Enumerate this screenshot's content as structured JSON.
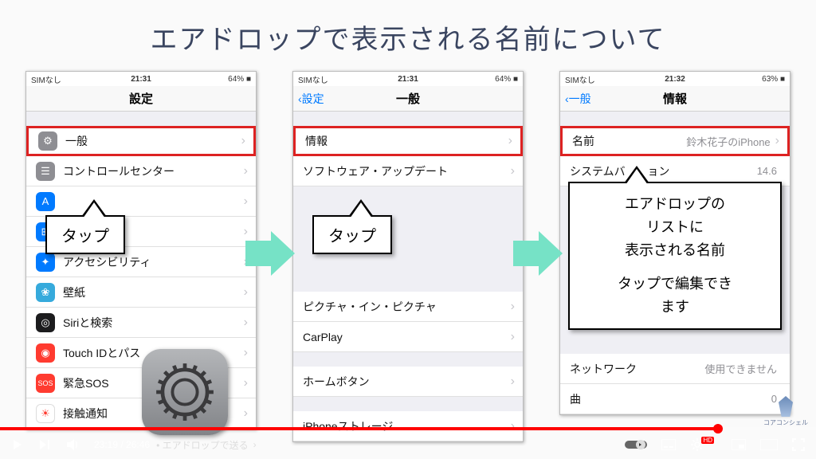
{
  "title": "エアドロップで表示される名前について",
  "statusbar": {
    "carrier": "SIMなし",
    "time1": "21:31",
    "time2": "21:31",
    "time3": "21:32",
    "battery1": "64%",
    "battery2": "64%",
    "battery3": "63%"
  },
  "phone1": {
    "nav_title": "設定",
    "cells": {
      "general": "一般",
      "control_center": "コントロールセンター",
      "hidden1": "",
      "hidden2": "",
      "accessibility": "アクセシビリティ",
      "wallpaper": "壁紙",
      "siri": "Siriと検索",
      "touchid": "Touch IDとパス",
      "sos": "緊急SOS",
      "exposure": "接触通知"
    },
    "callout": "タップ"
  },
  "phone2": {
    "back": "設定",
    "nav_title": "一般",
    "cells": {
      "about": "情報",
      "software_update": "ソフトウェア・アップデート",
      "pip": "ピクチャ・イン・ピクチャ",
      "carplay": "CarPlay",
      "home_button": "ホームボタン",
      "storage": "iPhoneストレージ"
    },
    "callout": "タップ"
  },
  "phone3": {
    "back": "一般",
    "nav_title": "情報",
    "cells": {
      "name_label": "名前",
      "name_value": "鈴木花子のiPhone",
      "system_version_label": "システムバ",
      "system_version_label2": "ョン",
      "system_version_value": "14.6",
      "network_label": "ネットワーク",
      "network_value": "使用できません",
      "songs_label": "曲",
      "songs_value": "0"
    },
    "callout_line1": "エアドロップの",
    "callout_line2": "リストに",
    "callout_line3": "表示される名前",
    "callout_line4": "タップで編集でき",
    "callout_line5": "ます"
  },
  "watermark": "コアコンシェル",
  "youtube": {
    "time": "23:19 / 26:46",
    "chapter": "エアドロップで送る"
  }
}
